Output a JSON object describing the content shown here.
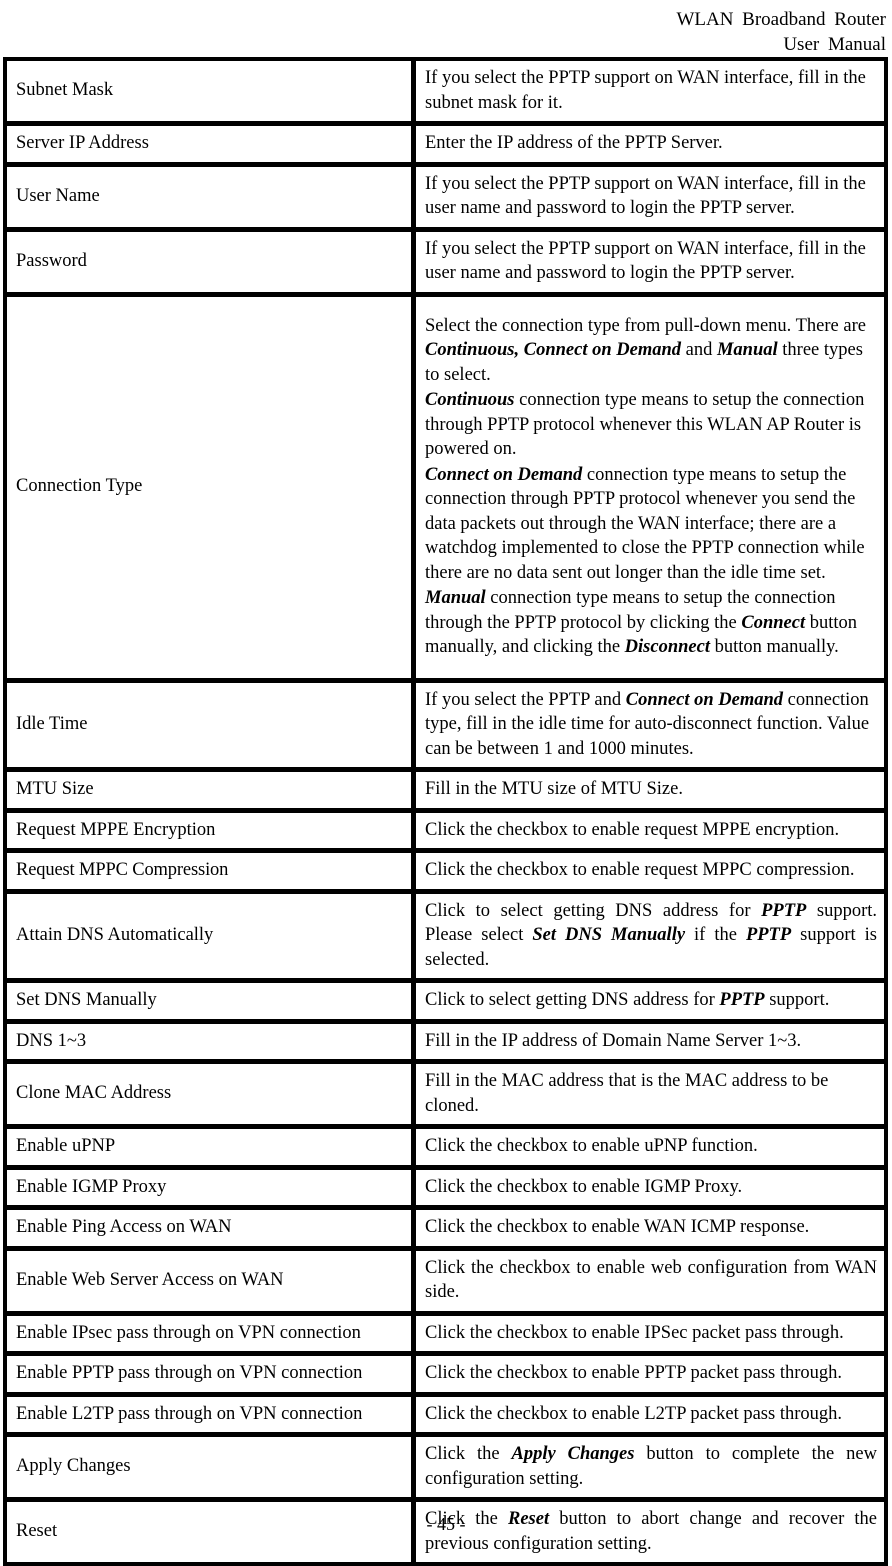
{
  "header": {
    "line1": "WLAN  Broadband  Router",
    "line2": "User  Manual"
  },
  "footer": {
    "page_number": "- 45 -"
  },
  "table": {
    "rows": [
      {
        "label": "Subnet Mask",
        "description": "If you select the PPTP support on WAN interface, fill in the subnet mask for it."
      },
      {
        "label": "Server IP Address",
        "description": "Enter the IP address of the PPTP Server."
      },
      {
        "label": "User Name",
        "description": "If you select the PPTP support on WAN interface, fill in the user name and password to login the PPTP server."
      },
      {
        "label": "Password",
        "description": "If you select the PPTP support on WAN interface, fill in the user name and password to login the PPTP server."
      },
      {
        "label": "Connection Type",
        "paragraphs": [
          {
            "parts": [
              {
                "t": "Select the connection type from pull-down menu. There are "
              },
              {
                "t": "Continuous, Connect on Demand",
                "b": true
              },
              {
                "t": " and "
              },
              {
                "t": "Manual",
                "b": true
              },
              {
                "t": " three types to select."
              }
            ]
          },
          {
            "parts": [
              {
                "t": "Continuous",
                "b": true
              },
              {
                "t": " connection type means to setup the connection through PPTP protocol whenever this WLAN AP Router is powered on."
              }
            ]
          },
          {
            "parts": [
              {
                "t": "Connect on Demand",
                "b": true
              },
              {
                "t": " connection type means to setup the connection through PPTP protocol whenever you send the data packets out through the WAN interface; there are a watchdog implemented to close the PPTP connection while there are no data sent out longer than the idle time set."
              }
            ]
          },
          {
            "parts": [
              {
                "t": "Manual",
                "b": true
              },
              {
                "t": " connection type means to setup the connection through the PPTP protocol by clicking the "
              },
              {
                "t": "Connect",
                "b": true
              },
              {
                "t": " button manually, and clicking the "
              },
              {
                "t": "Disconnect",
                "b": true
              },
              {
                "t": " button manually."
              }
            ]
          }
        ]
      },
      {
        "label": "Idle Time",
        "paragraphs": [
          {
            "parts": [
              {
                "t": "If you select the PPTP and "
              },
              {
                "t": "Connect on Demand",
                "b": true
              },
              {
                "t": " connection type, fill in the idle time for auto-disconnect function. Value can be between 1 and 1000 minutes."
              }
            ]
          }
        ]
      },
      {
        "label": "MTU Size",
        "description": "Fill in the MTU size of MTU Size."
      },
      {
        "label": "Request MPPE Encryption",
        "description": "Click the checkbox to enable request MPPE encryption."
      },
      {
        "label": "Request MPPC Compression",
        "description": "Click the checkbox to enable request MPPC compression."
      },
      {
        "label": "Attain DNS Automatically",
        "paragraphs": [
          {
            "parts": [
              {
                "t": "Click to select getting DNS address for "
              },
              {
                "t": "PPTP",
                "b": true
              },
              {
                "t": " support. Please select "
              },
              {
                "t": "Set DNS Manually",
                "b": true
              },
              {
                "t": " if the "
              },
              {
                "t": "PPTP",
                "b": true
              },
              {
                "t": " support is selected."
              }
            ]
          }
        ]
      },
      {
        "label": "Set DNS Manually",
        "paragraphs": [
          {
            "parts": [
              {
                "t": "Click to select getting DNS address for "
              },
              {
                "t": "PPTP",
                "b": true
              },
              {
                "t": " support."
              }
            ]
          }
        ]
      },
      {
        "label": "DNS 1~3",
        "description": "Fill in the IP address of Domain Name Server 1~3."
      },
      {
        "label": "Clone MAC Address",
        "description": "Fill in the MAC address that is the MAC address to be cloned."
      },
      {
        "label": "Enable uPNP",
        "description": "Click the checkbox to enable uPNP function."
      },
      {
        "label": "Enable IGMP Proxy",
        "description": "Click the checkbox to enable IGMP Proxy."
      },
      {
        "label": "Enable Ping Access on WAN",
        "description": "Click the checkbox to enable WAN ICMP response."
      },
      {
        "label": "Enable Web Server Access on WAN",
        "description": "Click the checkbox to enable web configuration from WAN side."
      },
      {
        "label": "Enable IPsec pass through on VPN connection",
        "description": "Click the checkbox to enable IPSec packet pass through."
      },
      {
        "label": "Enable PPTP pass through on VPN connection",
        "description": "Click the checkbox to enable PPTP packet pass through."
      },
      {
        "label": "Enable L2TP pass through on VPN connection",
        "description": "Click the checkbox to enable L2TP packet pass through."
      },
      {
        "label": "Apply Changes",
        "paragraphs": [
          {
            "parts": [
              {
                "t": "Click the "
              },
              {
                "t": "Apply Changes",
                "b": true
              },
              {
                "t": " button to complete the new configuration setting."
              }
            ]
          }
        ]
      },
      {
        "label": "Reset",
        "paragraphs": [
          {
            "parts": [
              {
                "t": "Click the "
              },
              {
                "t": "Reset",
                "b": true
              },
              {
                "t": " button to abort change and recover the previous configuration setting."
              }
            ]
          }
        ]
      }
    ]
  }
}
